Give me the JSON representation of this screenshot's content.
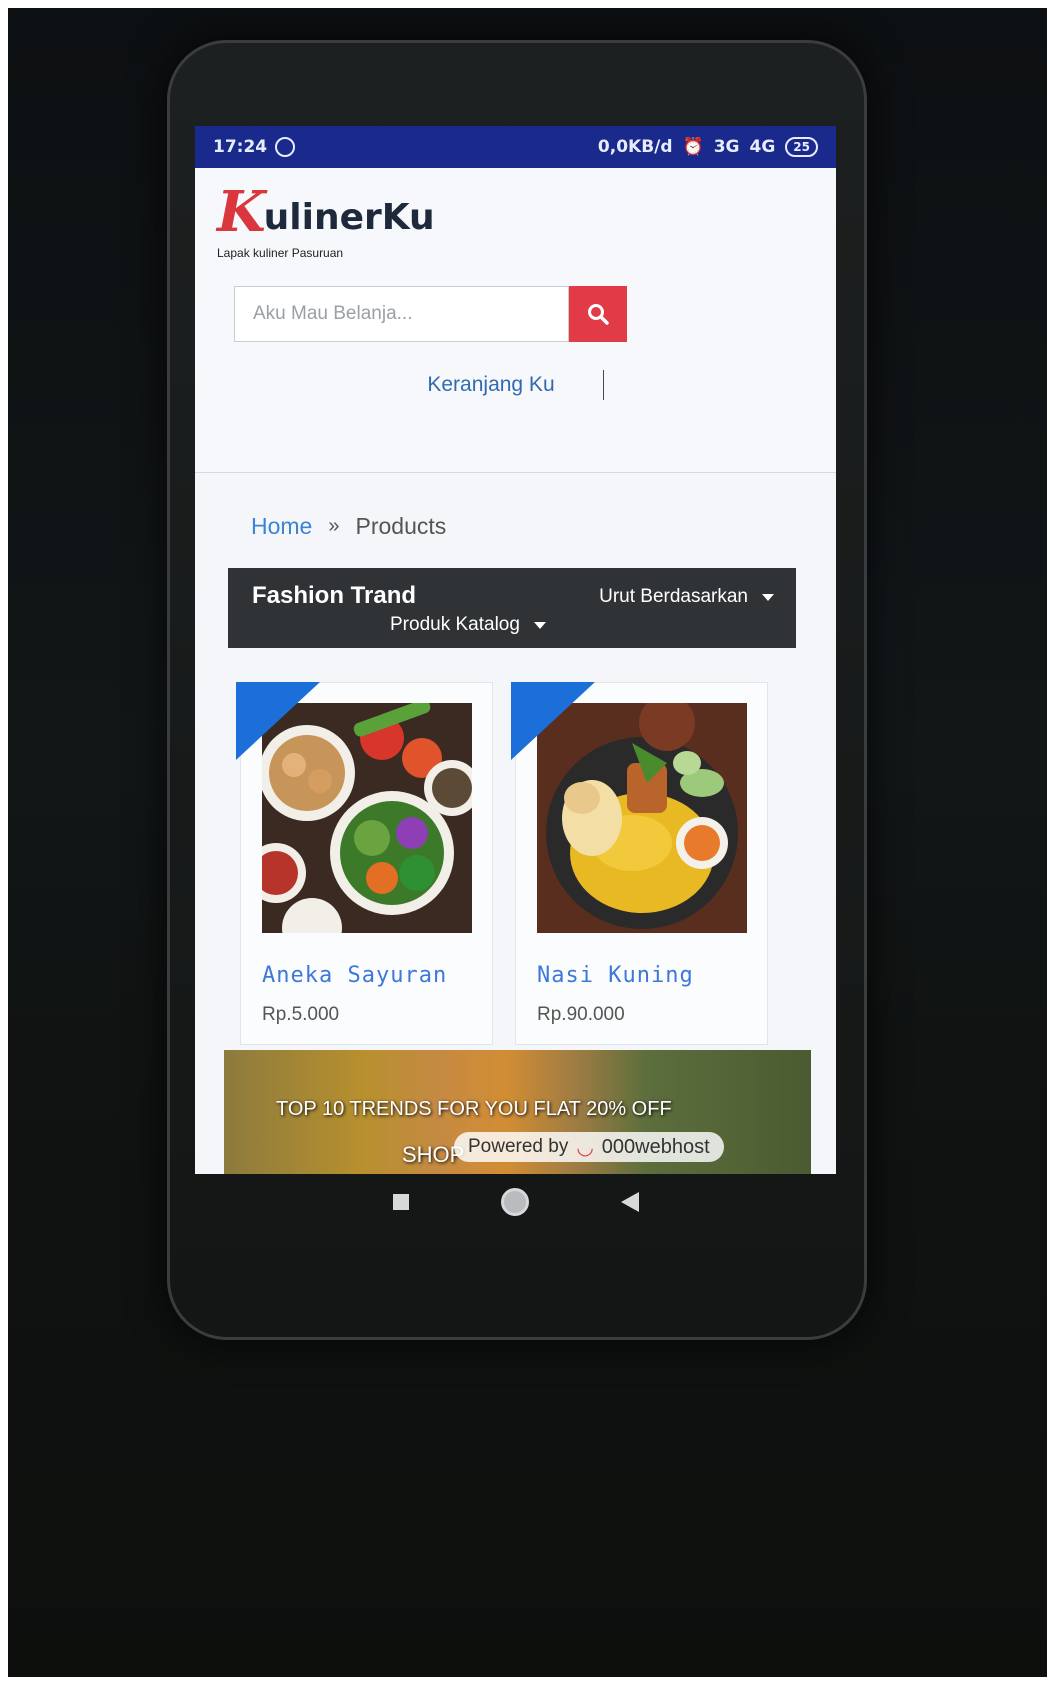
{
  "status_bar": {
    "time": "17:24",
    "network": "0,0KB/d",
    "signal": "3G",
    "signal2": "4G",
    "battery": "25"
  },
  "header": {
    "logo_mark": "K",
    "logo_text": "ulinerKu",
    "tagline": "Lapak kuliner Pasuruan",
    "search_placeholder": "Aku Mau Belanja...",
    "cart_label": "Keranjang Ku"
  },
  "breadcrumb": {
    "home": "Home",
    "separator": "»",
    "current": "Products"
  },
  "category_bar": {
    "title": "Fashion Trand",
    "sort_label": "Urut Berdasarkan",
    "catalog_label": "Produk Katalog"
  },
  "products": [
    {
      "name": "Aneka Sayuran",
      "price": "Rp.5.000"
    },
    {
      "name": "Nasi Kuning",
      "price": "Rp.90.000"
    }
  ],
  "banner": {
    "promo_text": "TOP 10 TRENDS FOR YOU FLAT 20% OFF",
    "shop_text": "SHOP",
    "powered_label": "Powered by",
    "host_name": "000webhost"
  },
  "colors": {
    "status_bar": "#1a2a8c",
    "accent_red": "#e23b48",
    "link_blue": "#2f6bb3",
    "ribbon_blue": "#1c6fd8",
    "category_bar": "#2f3336"
  }
}
